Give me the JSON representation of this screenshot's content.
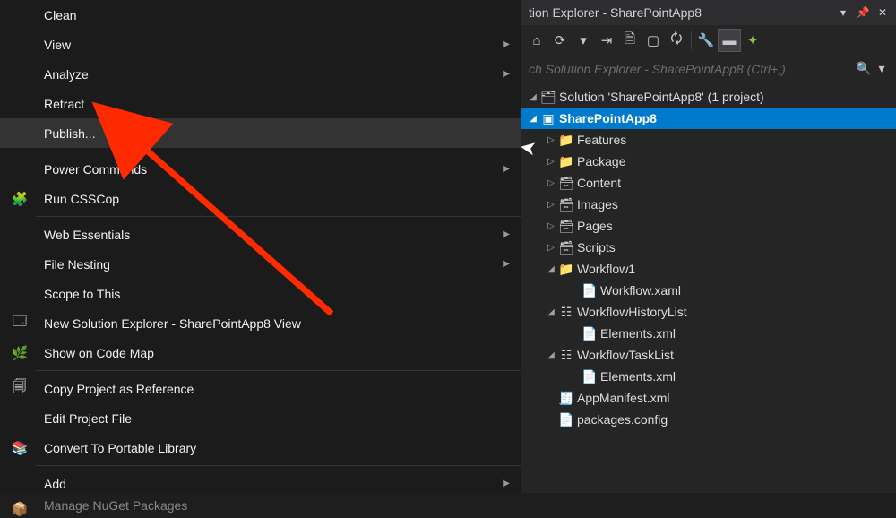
{
  "menu": {
    "clean": "Clean",
    "view": "View",
    "analyze": "Analyze",
    "retract": "Retract",
    "publish": "Publish...",
    "powercmds": "Power Commands",
    "csscop": "Run CSSCop",
    "webess": "Web Essentials",
    "filenest": "File Nesting",
    "scope": "Scope to This",
    "newsolexp": "New Solution Explorer - SharePointApp8 View",
    "codemap": "Show on Code Map",
    "copyref": "Copy Project as Reference",
    "editproj": "Edit Project File",
    "portable": "Convert To Portable Library",
    "add": "Add",
    "nuget": "Manage NuGet Packages"
  },
  "panel": {
    "title": "tion Explorer - SharePointApp8",
    "search_placeholder": "ch Solution Explorer - SharePointApp8 (Ctrl+;)"
  },
  "tree": {
    "root": "Solution 'SharePointApp8' (1 project)",
    "proj": "SharePointApp8",
    "features": "Features",
    "package": "Package",
    "content": "Content",
    "images": "Images",
    "pages": "Pages",
    "scripts": "Scripts",
    "workflow1": "Workflow1",
    "wfxaml": "Workflow.xaml",
    "wfhist": "WorkflowHistoryList",
    "elements1": "Elements.xml",
    "wftask": "WorkflowTaskList",
    "elements2": "Elements.xml",
    "manifest": "AppManifest.xml",
    "pkgconfig": "packages.config"
  }
}
